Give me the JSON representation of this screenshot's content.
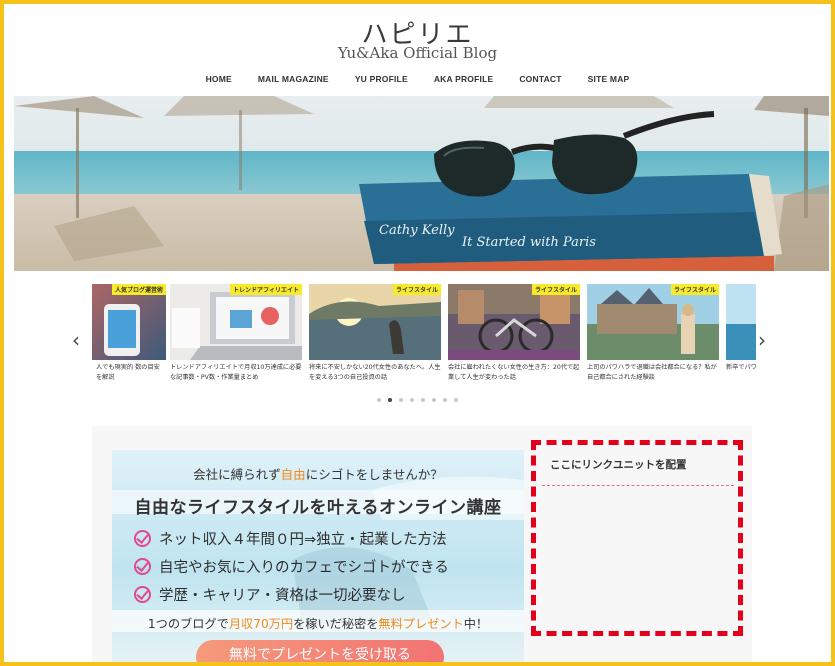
{
  "header": {
    "logo_jp": "ハピリエ",
    "logo_sub": "Yu&Aka Official Blog"
  },
  "nav": [
    "HOME",
    "MAIL MAGAZINE",
    "YU PROFILE",
    "AKA PROFILE",
    "CONTACT",
    "SITE MAP"
  ],
  "hero": {
    "book_title": "It Started with Paris",
    "book_author": "Cathy Kelly"
  },
  "carousel": {
    "prev": "‹",
    "next": "›",
    "slides": [
      {
        "tag": "人気ブログ運営術",
        "caption": "人でも現実的 数の目安を解説"
      },
      {
        "tag": "トレンドアフィリエイト",
        "caption": "トレンドアフィリエイトで月収10万達成に必要な記事数・PV数・作業量まとめ"
      },
      {
        "tag": "ライフスタイル",
        "caption": "将来に不安しかない20代女性のあなたへ。人生を変える3つの自己投資の話"
      },
      {
        "tag": "ライフスタイル",
        "caption": "会社に雇われたくない女性の生き方：20代で起業して人生が変わった話"
      },
      {
        "tag": "ライフスタイル",
        "caption": "上司のパワハラで退職は会社都合になる？私が自己都合にされた経験談"
      },
      {
        "tag": "",
        "caption": "新卒でパワハラ 退職した私が新"
      }
    ],
    "dot_count": 8,
    "active_dot": 1
  },
  "banner": {
    "line1_pre": "会社に縛られず",
    "line1_hl": "自由",
    "line1_post": "にシゴトをしませんか？",
    "title": "自由なライフスタイルを叶えるオンライン講座",
    "points": [
      "ネット収入４年間０円⇒独立・起業した方法",
      "自宅やお気に入りのカフェでシゴトができる",
      "学歴・キャリア・資格は一切必要なし"
    ],
    "present_pre": "1つのブログで",
    "present_hl1": "月収70万円",
    "present_mid": "を稼いだ秘密を",
    "present_hl2": "無料プレゼント",
    "present_post": "中！",
    "button": "無料でプレゼントを受け取る"
  },
  "widget": {
    "title": "ここにリンクユニットを配置"
  },
  "colors": {
    "frame": "#f5c21b",
    "tag": "#f6ea2b",
    "dashed_border": "#e3001b",
    "accent_orange": "#f08a1c",
    "check_pink": "#e24a8d"
  }
}
